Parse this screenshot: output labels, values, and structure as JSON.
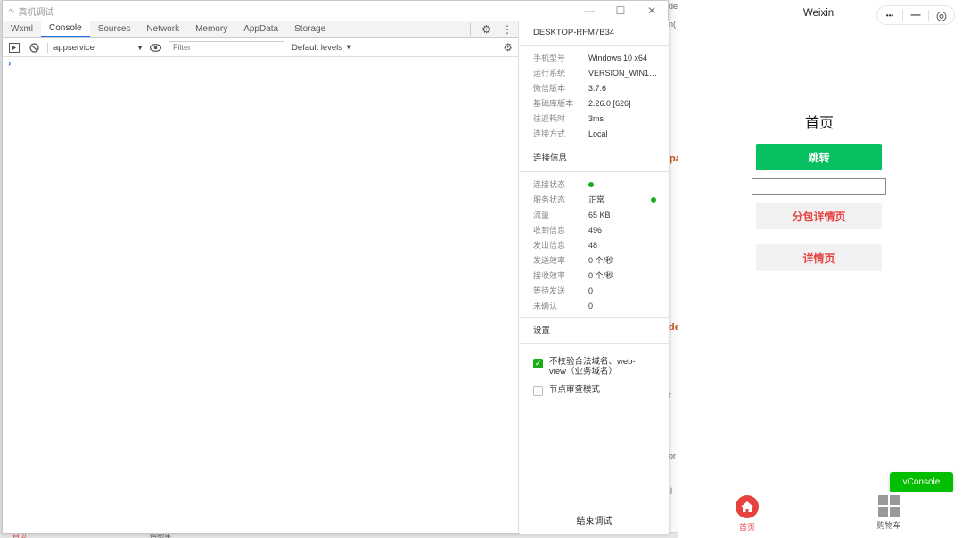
{
  "devtools": {
    "window_title": "真机调试",
    "window_controls": {
      "minimize": "—",
      "maximize": "☐",
      "close": "✕"
    },
    "tabs": [
      {
        "label": "Wxml"
      },
      {
        "label": "Console",
        "active": true
      },
      {
        "label": "Sources"
      },
      {
        "label": "Network"
      },
      {
        "label": "Memory"
      },
      {
        "label": "AppData"
      },
      {
        "label": "Storage"
      }
    ],
    "toolbar": {
      "context": "appservice",
      "filter_placeholder": "Filter",
      "levels": "Default levels ▼"
    },
    "console_prompt": "›",
    "device_name": "DESKTOP-RFM7B34",
    "device_info": [
      {
        "key": "手机型号",
        "value": "Windows 10 x64"
      },
      {
        "key": "运行系统",
        "value": "VERSION_WIN10..."
      },
      {
        "key": "微信版本",
        "value": "3.7.6"
      },
      {
        "key": "基础库版本",
        "value": "2.26.0 [626]"
      },
      {
        "key": "往返耗时",
        "value": "3ms"
      },
      {
        "key": "连接方式",
        "value": "Local"
      }
    ],
    "connection_title": "连接信息",
    "connection_info": [
      {
        "key": "连接状态",
        "value": ""
      },
      {
        "key": "服务状态",
        "value": "正常"
      },
      {
        "key": "流量",
        "value": "65 KB"
      },
      {
        "key": "收到信息",
        "value": "496"
      },
      {
        "key": "发出信息",
        "value": "48"
      },
      {
        "key": "发送效率",
        "value": "0 个/秒"
      },
      {
        "key": "接收效率",
        "value": "0 个/秒"
      },
      {
        "key": "等待发送",
        "value": "0"
      },
      {
        "key": "未确认",
        "value": "0"
      }
    ],
    "settings_title": "设置",
    "settings": [
      {
        "label": "不校验合法域名、web-view（业务域名）",
        "checked": true
      },
      {
        "label": "节点审查模式",
        "checked": false
      }
    ],
    "end_debug": "结束调试",
    "status_color": "#1aad19"
  },
  "phone": {
    "nav_title": "Weixin",
    "capsule": {
      "more": "•••",
      "minimize": "—",
      "target": "◎"
    },
    "page_heading": "首页",
    "jump_button": "跳转",
    "subpackage_button": "分包详情页",
    "detail_button": "详情页",
    "vconsole_button": "vConsole",
    "tabbar": [
      {
        "label": "首页",
        "active": true
      },
      {
        "label": "购物车"
      }
    ],
    "colors": {
      "primary": "#07c160",
      "danger": "#e64340",
      "vconsole": "#04be02"
    }
  },
  "background": {
    "fragments": [
      "de",
      "n(",
      "pa",
      "de",
      "or",
      "j",
      "r"
    ],
    "bottom_tabs": [
      "首页",
      "购物车"
    ]
  }
}
